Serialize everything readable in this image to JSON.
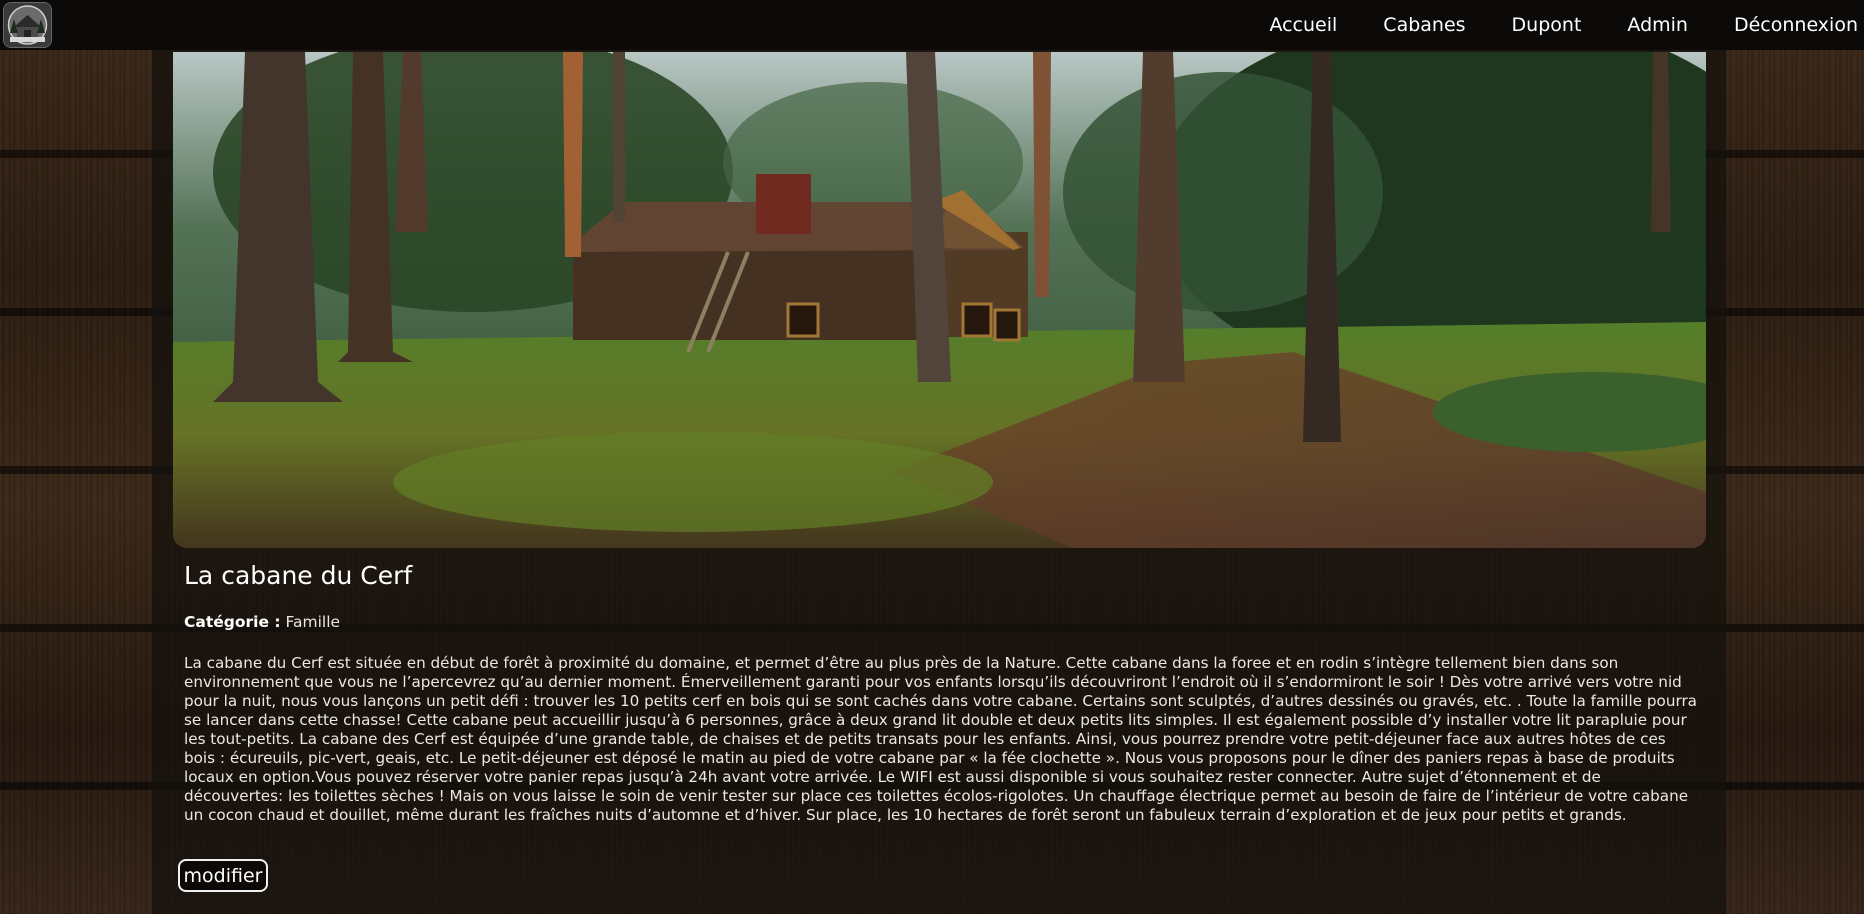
{
  "nav": {
    "logo_icon": "cabin-logo-icon",
    "links": [
      "Accueil",
      "Cabanes",
      "Dupont",
      "Admin",
      "Déconnexion"
    ]
  },
  "cabin": {
    "image_icon": "forest-cabin-photo",
    "title": "La cabane du Cerf",
    "category_label": "Catégorie :",
    "category_value": "Famille",
    "description": "La cabane du Cerf est située en début de forêt à proximité du domaine, et permet d’être au plus près de la Nature. Cette cabane dans la foree et en rodin s’intègre tellement bien dans son environnement que vous ne l’apercevrez qu’au dernier moment. Émerveillement garanti pour vos enfants lorsqu’ils découvriront l’endroit où il s’endormiront le soir ! Dès votre arrivé vers votre nid pour la nuit, nous vous lançons un petit défi : trouver les 10 petits cerf en bois qui se sont cachés dans votre cabane. Certains sont sculptés, d’autres dessinés ou gravés, etc. . Toute la famille pourra se lancer dans cette chasse! Cette cabane peut accueillir jusqu’à 6 personnes, grâce à deux grand lit double et deux petits lits simples. Il est également possible d’y installer votre lit parapluie pour les tout-petits. La cabane des Cerf est équipée d’une grande table, de chaises et de petits transats pour les enfants. Ainsi, vous pourrez prendre votre petit-déjeuner face aux autres hôtes de ces bois : écureuils, pic-vert, geais, etc. Le petit-déjeuner est déposé le matin au pied de votre cabane par « la fée clochette ». Nous vous proposons pour le dîner des paniers repas à base de produits locaux en option.Vous pouvez réserver votre panier repas jusqu’à 24h avant votre arrivée. Le WIFI est aussi disponible si vous souhaitez rester connecter. Autre sujet d’étonnement et de découvertes: les toilettes sèches ! Mais on vous laisse le soin de venir tester sur place ces toilettes écolos-rigolotes. Un chauffage électrique permet au besoin de faire de l’intérieur de votre cabane  un cocon chaud et douillet, même durant les fraîches nuits d’automne et d’hiver. Sur place, les 10 hectares de forêt seront un fabuleux terrain d’exploration et de jeux pour petits et grands.",
    "modify_label": "modifier"
  }
}
